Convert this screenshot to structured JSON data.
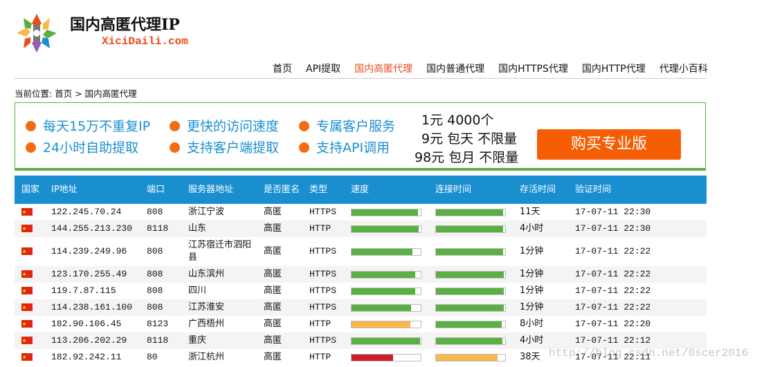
{
  "header": {
    "title": "国内高匿代理IP",
    "subtitle": "XiciDaili.com"
  },
  "nav": {
    "items": [
      {
        "label": "首页",
        "active": false
      },
      {
        "label": "API提取",
        "active": false
      },
      {
        "label": "国内高匿代理",
        "active": true
      },
      {
        "label": "国内普通代理",
        "active": false
      },
      {
        "label": "国内HTTPS代理",
        "active": false
      },
      {
        "label": "国内HTTP代理",
        "active": false
      },
      {
        "label": "代理小百科",
        "active": false
      }
    ]
  },
  "breadcrumb": {
    "prefix": "当前位置:",
    "home": "首页",
    "sep": ">",
    "current": "国内高匿代理"
  },
  "banner": {
    "features": [
      "每天15万不重复IP",
      "24小时自助提取",
      "更快的访问速度",
      "支持客户端提取",
      "专属客户服务",
      "支持API调用"
    ],
    "prices": [
      "1元 4000个",
      "9元 包天 不限量",
      "98元 包月 不限量"
    ],
    "buy_label": "购买专业版"
  },
  "colors": {
    "accent": "#1a8fd0",
    "highlight": "#e84d1c",
    "bar_green": "#5bb043",
    "bar_orange": "#f8b84e",
    "bar_red": "#cc1f2e"
  },
  "table": {
    "headers": [
      "国家",
      "IP地址",
      "端口",
      "服务器地址",
      "是否匿名",
      "类型",
      "速度",
      "连接时间",
      "存活时间",
      "验证时间"
    ],
    "rows": [
      {
        "country_icon": "china-flag-icon",
        "ip": "122.245.70.24",
        "port": "808",
        "location": "浙江宁波",
        "anon": "高匿",
        "type": "HTTPS",
        "speed": 0.96,
        "speed_color": "green",
        "conn": 0.97,
        "conn_color": "green",
        "alive": "11天",
        "verified": "17-07-11 22:30"
      },
      {
        "country_icon": "china-flag-icon",
        "ip": "144.255.213.230",
        "port": "8118",
        "location": "山东",
        "anon": "高匿",
        "type": "HTTP",
        "speed": 0.97,
        "speed_color": "green",
        "conn": 0.97,
        "conn_color": "green",
        "alive": "4小时",
        "verified": "17-07-11 22:30"
      },
      {
        "country_icon": "china-flag-icon",
        "ip": "114.239.249.96",
        "port": "808",
        "location": "江苏宿迁市泗阳县",
        "anon": "高匿",
        "type": "HTTPS",
        "speed": 0.88,
        "speed_color": "green",
        "conn": 0.97,
        "conn_color": "green",
        "alive": "1分钟",
        "verified": "17-07-11 22:22"
      },
      {
        "country_icon": "china-flag-icon",
        "ip": "123.170.255.49",
        "port": "808",
        "location": "山东滨州",
        "anon": "高匿",
        "type": "HTTPS",
        "speed": 0.92,
        "speed_color": "green",
        "conn": 0.98,
        "conn_color": "green",
        "alive": "1分钟",
        "verified": "17-07-11 22:22"
      },
      {
        "country_icon": "china-flag-icon",
        "ip": "119.7.87.115",
        "port": "808",
        "location": "四川",
        "anon": "高匿",
        "type": "HTTPS",
        "speed": 0.92,
        "speed_color": "green",
        "conn": 0.98,
        "conn_color": "green",
        "alive": "1分钟",
        "verified": "17-07-11 22:22"
      },
      {
        "country_icon": "china-flag-icon",
        "ip": "114.238.161.100",
        "port": "808",
        "location": "江苏淮安",
        "anon": "高匿",
        "type": "HTTPS",
        "speed": 0.86,
        "speed_color": "green",
        "conn": 0.98,
        "conn_color": "green",
        "alive": "1分钟",
        "verified": "17-07-11 22:22"
      },
      {
        "country_icon": "china-flag-icon",
        "ip": "182.90.106.45",
        "port": "8123",
        "location": "广西梧州",
        "anon": "高匿",
        "type": "HTTP",
        "speed": 0.85,
        "speed_color": "orange",
        "conn": 0.95,
        "conn_color": "green",
        "alive": "8小时",
        "verified": "17-07-11 22:20"
      },
      {
        "country_icon": "china-flag-icon",
        "ip": "113.206.202.29",
        "port": "8118",
        "location": "重庆",
        "anon": "高匿",
        "type": "HTTPS",
        "speed": 0.99,
        "speed_color": "green",
        "conn": 0.96,
        "conn_color": "green",
        "alive": "4小时",
        "verified": "17-07-11 22:12"
      },
      {
        "country_icon": "china-flag-icon",
        "ip": "182.92.242.11",
        "port": "80",
        "location": "浙江杭州",
        "anon": "高匿",
        "type": "HTTP",
        "speed": 0.6,
        "speed_color": "red",
        "conn": 0.89,
        "conn_color": "orange",
        "alive": "38天",
        "verified": "17-07-11 22:11"
      }
    ]
  },
  "watermark": "http://blog.csdn.net/0scer2016"
}
